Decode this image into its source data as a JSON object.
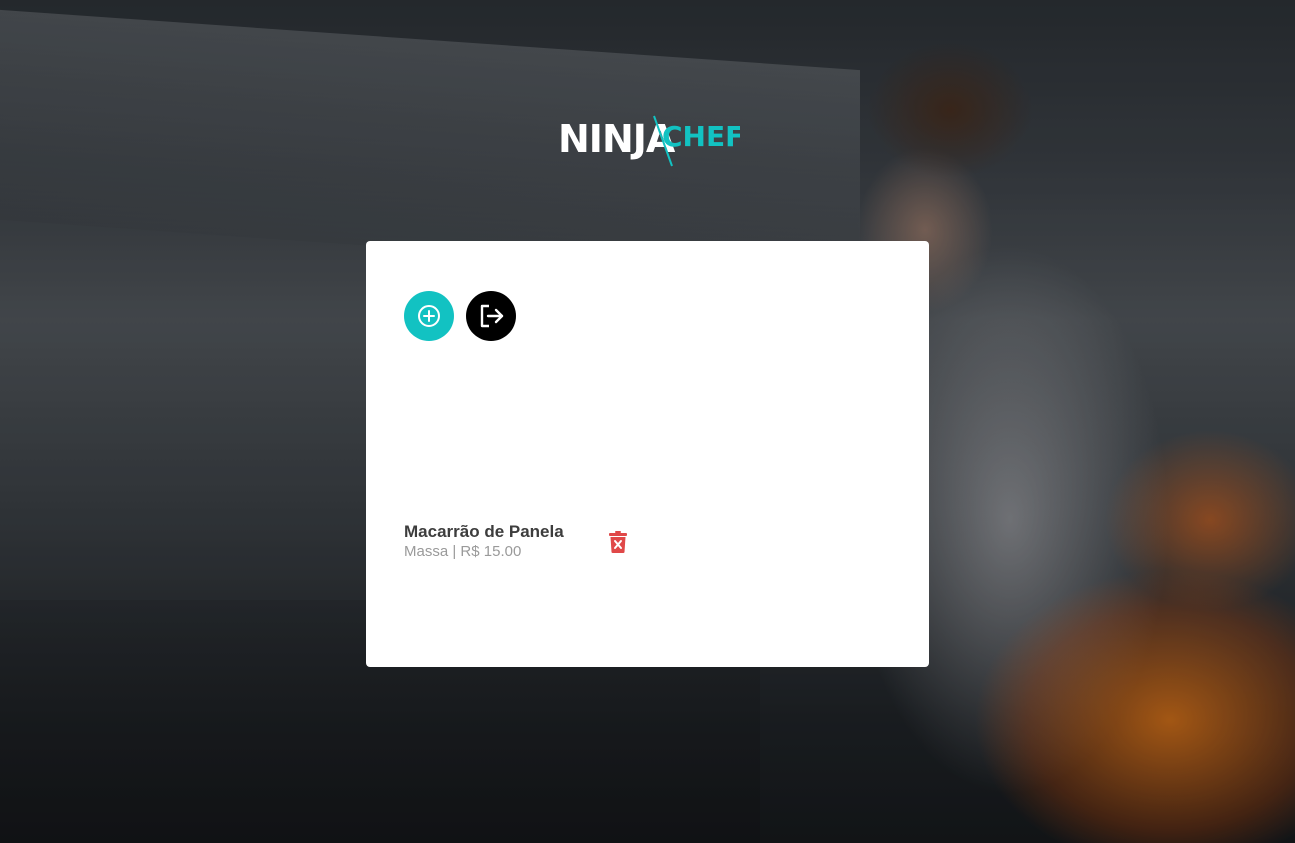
{
  "brand": {
    "name_white": "NINJA",
    "name_accent": "CHEF",
    "accent_color": "#12c2c2"
  },
  "toolbar": {
    "add_icon": "plus-circle-icon",
    "logout_icon": "logout-icon",
    "add_color": "#12c2c2",
    "logout_color": "#000000"
  },
  "menu": {
    "items": [
      {
        "name": "Macarrão de Panela",
        "meta": "Massa | R$ 15.00",
        "delete_icon": "trash-icon",
        "delete_color": "#e04848"
      }
    ]
  }
}
